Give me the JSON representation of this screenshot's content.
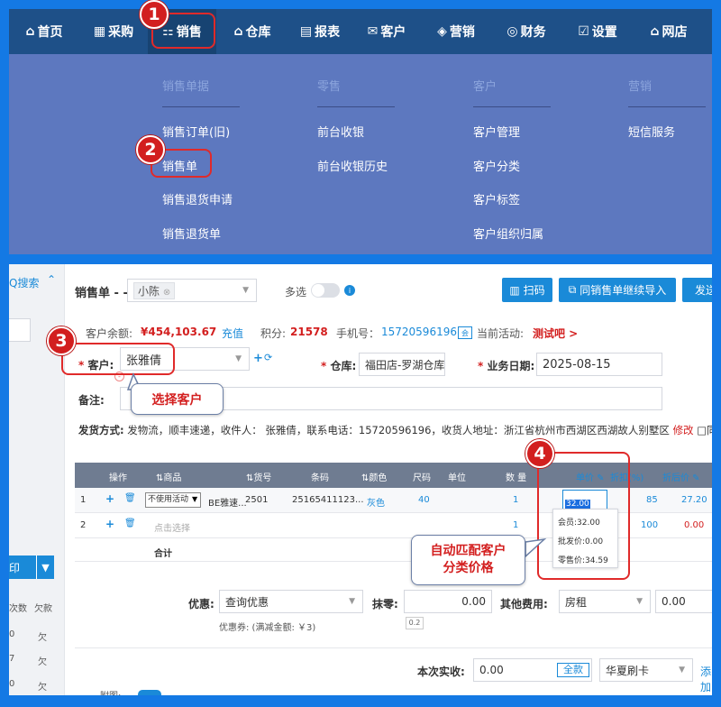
{
  "nav": {
    "items": [
      {
        "icon": "home-icon",
        "glyph": "⌂",
        "label": "首页"
      },
      {
        "icon": "shop-icon",
        "glyph": "▦",
        "label": "采购"
      },
      {
        "icon": "cart-icon",
        "glyph": "▦",
        "label": "销售"
      },
      {
        "icon": "warehouse-icon",
        "glyph": "⌂",
        "label": "仓库"
      },
      {
        "icon": "report-icon",
        "glyph": "▤",
        "label": "报表"
      },
      {
        "icon": "mail-icon",
        "glyph": "✉",
        "label": "客户"
      },
      {
        "icon": "tag-icon",
        "glyph": "◈",
        "label": "营销"
      },
      {
        "icon": "money-icon",
        "glyph": "◎",
        "label": "财务"
      },
      {
        "icon": "settings-icon",
        "glyph": "☑",
        "label": "设置"
      },
      {
        "icon": "store-icon",
        "glyph": "⌂",
        "label": "网店"
      }
    ],
    "active_index": 2
  },
  "menu": {
    "col1": {
      "header": "销售单据",
      "items": [
        "销售订单(旧)",
        "销售单",
        "销售退货申请",
        "销售退货单"
      ]
    },
    "col2": {
      "header": "零售",
      "items": [
        "前台收银",
        "前台收银历史"
      ]
    },
    "col3": {
      "header": "客户",
      "items": [
        "客户管理",
        "客户分类",
        "客户标签",
        "客户组织归属"
      ]
    },
    "col4": {
      "header": "营销",
      "items": [
        "短信服务"
      ]
    }
  },
  "callouts": {
    "c1": "1",
    "c2": "2",
    "c3": "3",
    "c4": "4"
  },
  "tooltips": {
    "select_customer": "选择客户",
    "auto_match_line1": "自动匹配客户",
    "auto_match_line2": "分类价格"
  },
  "left": {
    "search_label": "Q搜索",
    "print_label": "印",
    "cols": [
      "次数",
      "欠款"
    ],
    "rows": [
      [
        "0",
        "欠"
      ],
      [
        "7",
        "欠"
      ],
      [
        "0",
        "欠"
      ]
    ]
  },
  "form": {
    "title": "销售单 - -",
    "salesperson": "小陈",
    "multi_label": "多选",
    "btn_scan": "扫码",
    "btn_import": "同销售单继续导入",
    "btn_send": "发送给",
    "balance_label": "客户余额:",
    "balance_value": "¥454,103.67",
    "recharge": "充值",
    "points_label": "积分:",
    "points_value": "21578",
    "phone_label": "手机号：",
    "phone_value": "15720596196",
    "activity_label": "当前活动:",
    "activity_value": "测试吧 >",
    "customer_label": "客户:",
    "customer_value": "张雅倩",
    "warehouse_label": "仓库:",
    "warehouse_value": "福田店-罗湖仓库",
    "date_label": "业务日期:",
    "date_value": "2025-08-15",
    "remark_label": "备注:",
    "shipping_label": "发货方式:",
    "shipping_text": "发物流，顺丰速递，收件人： 张雅倩，联系电话：15720596196，收货人地址：浙江省杭州市西湖区西湖故人别墅区",
    "modify": "修改",
    "sync": "□同步至"
  },
  "table": {
    "headers": [
      "操作",
      "⇅商品",
      "⇅货号",
      "条码",
      "⇅颜色",
      "尺码",
      "单位",
      "数 量",
      "单价 ✎",
      "折扣(%)",
      "折后价 ✎"
    ],
    "rows": [
      {
        "idx": "1",
        "promo": "不使用活动",
        "product": "BE雅速...",
        "sku": "2501",
        "barcode": "25165411123...",
        "color": "灰色",
        "size": "40",
        "qty": "1",
        "price": "32.00",
        "discount": "85",
        "after": "27.20"
      },
      {
        "idx": "2",
        "promo": "",
        "product": "点击选择",
        "sku": "",
        "barcode": "",
        "color": "",
        "size": "",
        "qty": "1",
        "price": "",
        "discount": "100",
        "after": "0.00"
      }
    ],
    "total_label": "合计"
  },
  "price_popup": {
    "member": "会员:32.00",
    "wholesale": "批发价:0.00",
    "retail": "零售价:34.59"
  },
  "footer": {
    "discount_label": "优惠:",
    "discount_value": "查询优惠",
    "coupon": "优惠券: (满减金额: ￥3)",
    "round_label": "抹零:",
    "round_value": "0.00",
    "round_hint": "0.2",
    "other_label": "其他费用:",
    "other_type": "房租",
    "other_value": "0.00",
    "paid_label": "本次实收:",
    "paid_value": "0.00",
    "full_btn": "全款",
    "bank": "华夏刷卡",
    "add": "添加",
    "attach": "附图:"
  }
}
